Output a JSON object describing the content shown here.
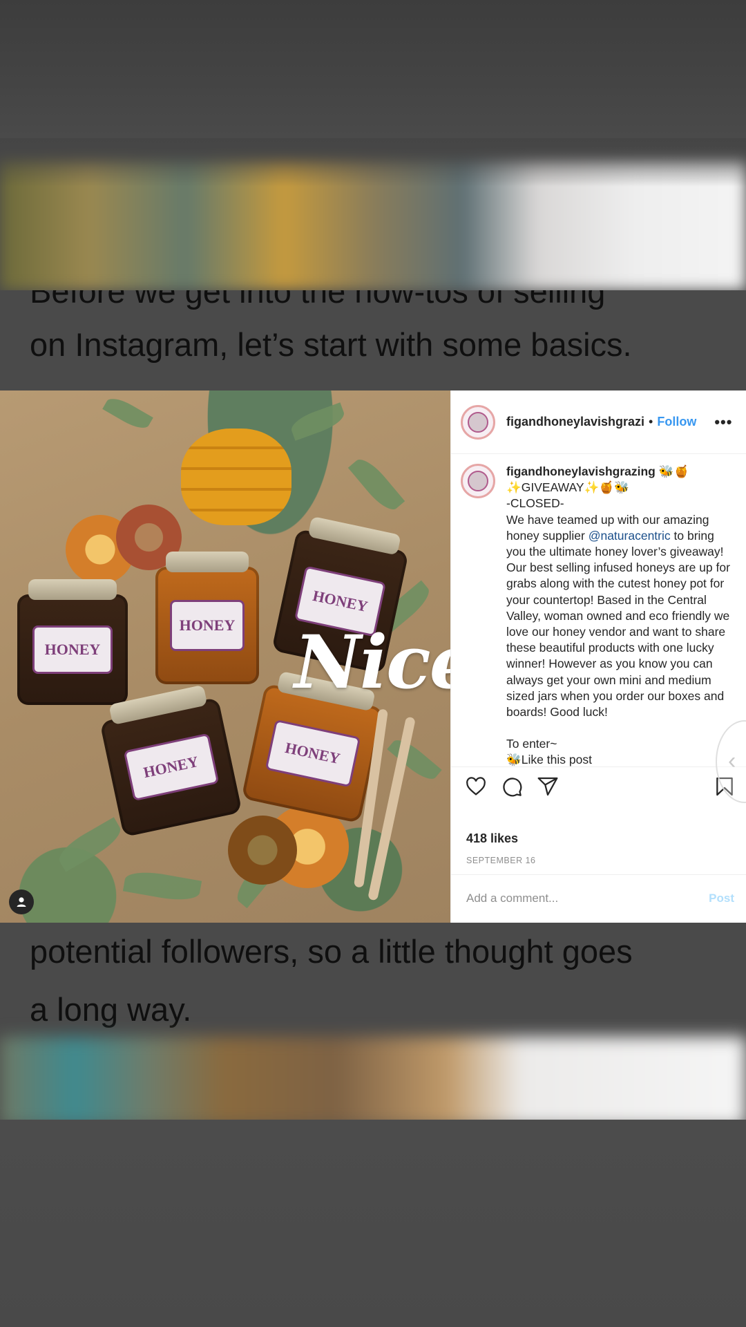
{
  "article": {
    "clipped_line": "Before we get into the how-tos of selling",
    "line_basics": "on Instagram, let’s start with some basics.",
    "line_followers": "potential followers, so a little thought goes",
    "line_long_way": "a long way."
  },
  "post": {
    "overlay_text": "Nice",
    "username": "figandhoneylavishgrazi",
    "separator": "•",
    "follow_label": "Follow",
    "more_label": "•••",
    "caption": {
      "username": "figandhoneylavishgrazing",
      "title_emoji": "🐝🍯",
      "line_giveaway": "✨GIVEAWAY✨🍯🐝",
      "line_closed": "-CLOSED-",
      "body_before_mention": "We have teamed up with our amazing honey supplier ",
      "mention": "@naturacentric",
      "body_after_mention": " to bring you the ultimate honey lover’s giveaway! Our best selling infused honeys are up for grabs along with the cutest honey pot for your countertop! Based in the Central Valley, woman owned and eco friendly we love our honey vendor and want to share these beautiful products with one lucky winner! However as you know you can always get your own mini and medium sized jars when you order our boxes and boards! Good luck!",
      "to_enter": "To enter~",
      "like_line": "🐝Like this post"
    },
    "likes": "418 likes",
    "date": "SEPTEMBER 16",
    "comment_placeholder": "Add a comment...",
    "post_label": "Post",
    "jar_labels": [
      "HONEY",
      "HONEY",
      "HONEY",
      "HONEY",
      "HONEY"
    ]
  },
  "colors": {
    "link_blue": "#3897f0",
    "mention_blue": "#1b4f8a",
    "post_disabled": "#b2dffc"
  }
}
